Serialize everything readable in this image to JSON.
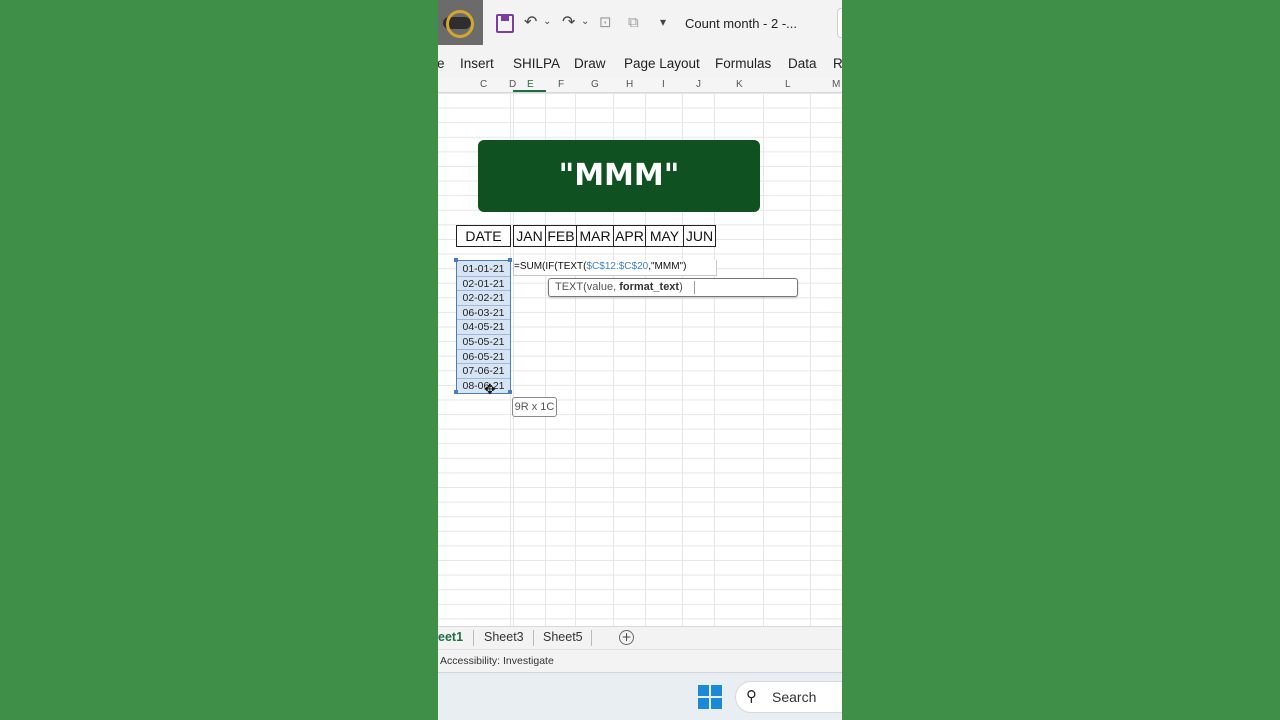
{
  "titlebar": {
    "doc_title": "Count month  -  2  -...",
    "undo_icon": "undo-icon",
    "redo_icon": "redo-icon",
    "dropdown": "▾"
  },
  "ribbon": {
    "tabs": [
      "e",
      "Insert",
      "SHILPA",
      "Draw",
      "Page Layout",
      "Formulas",
      "Data",
      "R"
    ]
  },
  "columns": [
    "C",
    "D",
    "E",
    "F",
    "G",
    "H",
    "I",
    "J",
    "K",
    "L",
    "M"
  ],
  "banner": {
    "text": "\"MMM\"",
    "color": "#0f5120"
  },
  "table_header": {
    "date": "DATE",
    "months": [
      "JAN",
      "FEB",
      "MAR",
      "APR",
      "MAY",
      "JUN"
    ]
  },
  "dates": [
    "01-01-21",
    "02-01-21",
    "02-02-21",
    "06-03-21",
    "04-05-21",
    "05-05-21",
    "06-05-21",
    "07-06-21",
    "08-06-21"
  ],
  "formula": {
    "prefix": "=SUM(IF(TEXT(",
    "ref": "$C$12:$C$20",
    "suffix": ",\"MMM\")"
  },
  "tooltip": {
    "func": "TEXT(value, ",
    "bold_arg": "format_text",
    "close": ")"
  },
  "selection_size": "9R x 1C",
  "sheets": [
    "eet1",
    "Sheet3",
    "Sheet5"
  ],
  "add_sheet": "+",
  "status": "Accessibility: Investigate",
  "taskbar": {
    "search_label": "Search"
  }
}
